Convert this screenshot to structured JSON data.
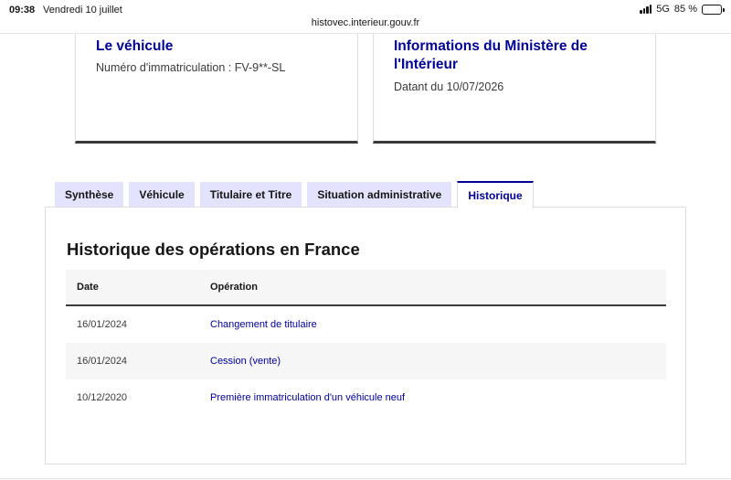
{
  "status_bar": {
    "time": "09:38",
    "date": "Vendredi 10 juillet",
    "network": "5G",
    "battery": "85 %",
    "battery_level": 0.85
  },
  "browser": {
    "url": "histovec.interieur.gouv.fr"
  },
  "cards": {
    "vehicle": {
      "title": "Le véhicule",
      "text": "Numéro d'immatriculation : FV-9**-SL"
    },
    "ministry": {
      "title": "Informations du Ministère de l'Intérieur",
      "text": "Datant du 10/07/2026"
    }
  },
  "tabs": [
    {
      "label": "Synthèse",
      "active": false
    },
    {
      "label": "Véhicule",
      "active": false
    },
    {
      "label": "Titulaire et Titre",
      "active": false
    },
    {
      "label": "Situation administrative",
      "active": false
    },
    {
      "label": "Historique",
      "active": true
    }
  ],
  "history": {
    "title": "Historique des opérations en France",
    "columns": {
      "date": "Date",
      "operation": "Opération"
    },
    "rows": [
      {
        "date": "16/01/2024",
        "operation": "Changement de titulaire"
      },
      {
        "date": "16/01/2024",
        "operation": "Cession (vente)"
      },
      {
        "date": "10/12/2020",
        "operation": "Première immatriculation d'un véhicule neuf"
      }
    ]
  },
  "colors": {
    "accent": "#000091",
    "tab_background": "#e3e3fd",
    "text": "#161616"
  }
}
